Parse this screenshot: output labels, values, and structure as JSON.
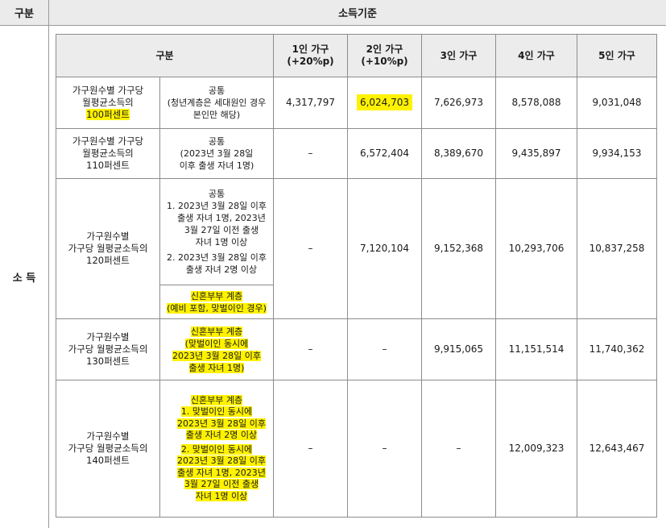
{
  "outer": {
    "col_header": "구분",
    "title": "소득기준",
    "row_label": "소 득"
  },
  "table": {
    "headers": {
      "category": "구분",
      "h1_line1": "1인 가구",
      "h1_line2": "(+20%p)",
      "h2_line1": "2인 가구",
      "h2_line2": "(+10%p)",
      "h3": "3인 가구",
      "h4": "4인 가구",
      "h5": "5인 가구"
    },
    "rows": [
      {
        "label": [
          "가구원수별 가구당",
          "월평균소득의",
          "100퍼센트"
        ],
        "cond": [
          "공통",
          "(청년계층은 세대원인 경우",
          "본인만 해당)"
        ],
        "values": [
          "4,317,797",
          "6,024,703",
          "7,626,973",
          "8,578,088",
          "9,031,048"
        ]
      },
      {
        "label": [
          "가구원수별 가구당",
          "월평균소득의",
          "110퍼센트"
        ],
        "cond": [
          "공통",
          "(2023년 3월 28일",
          "이후 출생 자녀 1명)"
        ],
        "values": [
          "–",
          "6,572,404",
          "8,389,670",
          "9,435,897",
          "9,934,153"
        ]
      },
      {
        "label": [
          "가구원수별",
          "가구당 월평균소득의",
          "120퍼센트"
        ],
        "cond_title": "공통",
        "cond_items": [
          [
            "1. 2023년 3월 28일 이후",
            "출생 자녀 1명, 2023년",
            "3월 27일 이전 출생",
            "자녀 1명 이상"
          ],
          [
            "2. 2023년 3월 28일 이후",
            "출생 자녀 2명 이상"
          ]
        ],
        "cond2": [
          "신혼부부 계층",
          "(예비 포함, 맞벌이인 경우)"
        ],
        "values": [
          "–",
          "7,120,104",
          "9,152,368",
          "10,293,706",
          "10,837,258"
        ]
      },
      {
        "label": [
          "가구원수별",
          "가구당 월평균소득의",
          "130퍼센트"
        ],
        "cond": [
          "신혼부부 계층",
          "(맞벌이인 동시에",
          "2023년 3월 28일 이후",
          "출생 자녀 1명)"
        ],
        "values": [
          "–",
          "–",
          "9,915,065",
          "11,151,514",
          "11,740,362"
        ]
      },
      {
        "label": [
          "가구원수별",
          "가구당 월평균소득의",
          "140퍼센트"
        ],
        "cond_title": "신혼부부 계층",
        "cond_items": [
          [
            "1. 맞벌이인 동시에",
            "2023년 3월 28일 이후",
            "출생 자녀 2명 이상"
          ],
          [
            "2. 맞벌이인 동시에",
            "2023년 3월 28일 이후",
            "출생 자녀 1명, 2023년",
            "3월 27일 이전 출생",
            "자녀 1명 이상"
          ]
        ],
        "values": [
          "–",
          "–",
          "–",
          "12,009,323",
          "12,643,467"
        ]
      }
    ]
  },
  "colors": {
    "highlight": "#fff200",
    "header_bg": "#ececec",
    "border": "#8c8c8c"
  }
}
